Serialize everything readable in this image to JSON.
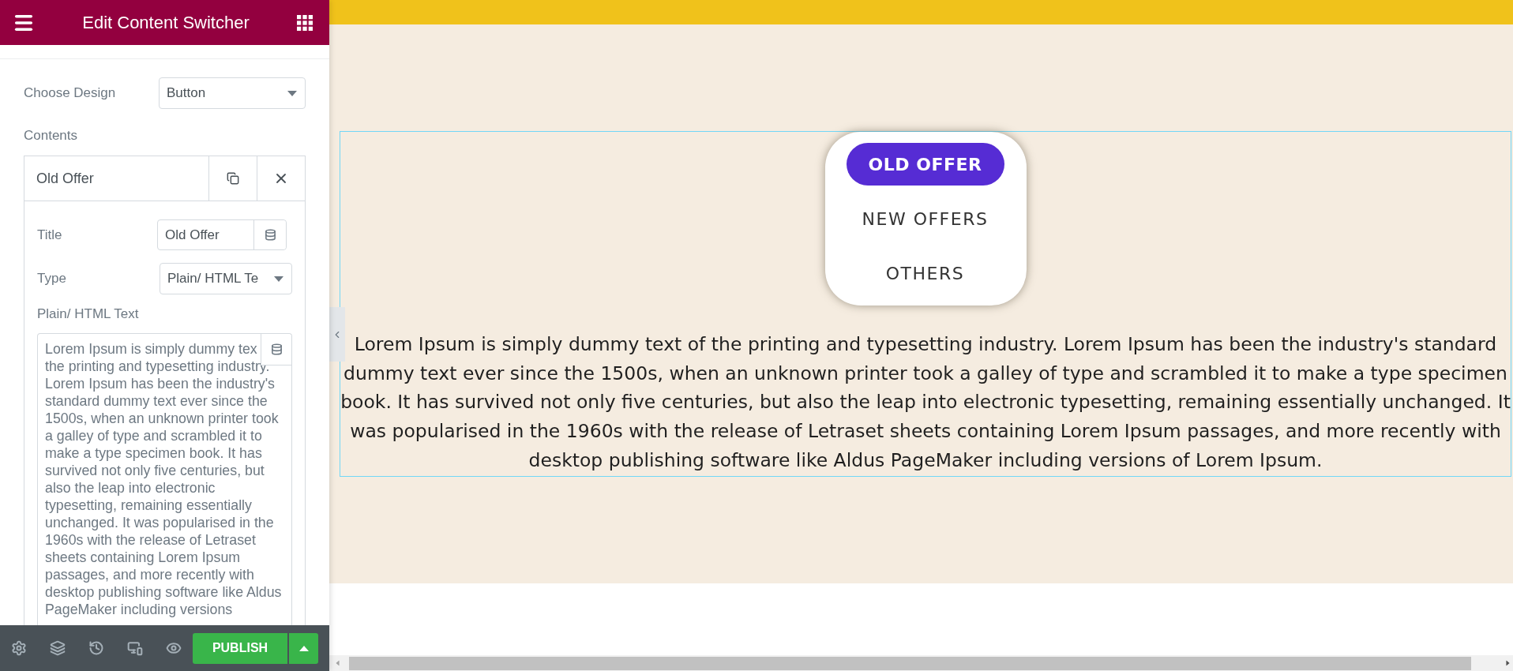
{
  "editor_panel": {
    "title": "Edit Content Switcher",
    "design": {
      "label": "Choose Design",
      "value": "Button"
    },
    "contents_label": "Contents",
    "items": [
      {
        "title": "Old Offer",
        "expanded": true,
        "fields": [
          {
            "kind": "text",
            "label": "Title",
            "value": "Old Offer"
          },
          {
            "kind": "select",
            "label": "Type",
            "value": "Plain/ HTML Te"
          },
          {
            "kind": "textarea",
            "label": "Plain/ HTML Text",
            "value": "Lorem Ipsum is simply dummy tex the printing and typesetting industry. Lorem Ipsum has been the industry's standard dummy text ever since the 1500s, when an unknown printer took a galley of type and scrambled it to make a type specimen book. It has survived not only five centuries, but also the leap into electronic typesetting, remaining essentially unchanged. It was popularised in the 1960s with the release of Letraset sheets containing Lorem Ipsum passages, and more recently with desktop publishing software like Aldus PageMaker including versions"
          }
        ]
      }
    ],
    "publish_label": "PUBLISH"
  },
  "canvas": {
    "switcher_options": [
      {
        "label": "OLD OFFER",
        "selected": true
      },
      {
        "label": "NEW OFFERS",
        "selected": false
      },
      {
        "label": "OTHERS",
        "selected": false
      }
    ],
    "paragraph": "Lorem Ipsum is simply dummy text of the printing and typesetting industry. Lorem Ipsum has been the industry's standard dummy text ever since the 1500s, when an unknown printer took a galley of type and scrambled it to make a type specimen book. It has survived not only five centuries, but also the leap into electronic typesetting, remaining essentially unchanged. It was popularised in the 1960s with the release of Letraset sheets containing Lorem Ipsum passages, and more recently with desktop publishing software like Aldus PageMaker including versions of Lorem Ipsum."
  }
}
